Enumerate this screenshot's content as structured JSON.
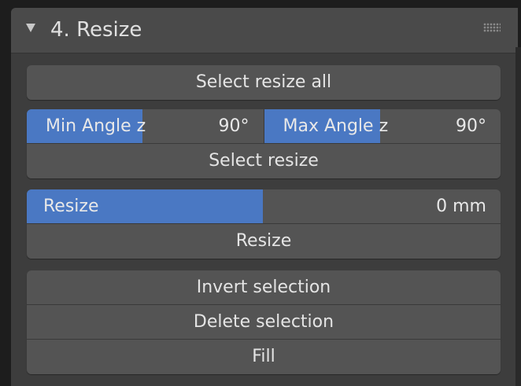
{
  "panel": {
    "title": "4. Resize",
    "collapse_icon": "triangle-down-icon",
    "grip_icon": "drag-grip-icon"
  },
  "select_resize_all": {
    "label": "Select resize all"
  },
  "angle_row": {
    "min": {
      "label": "Min Angle z",
      "value": "90°",
      "fill_fraction": 0.49
    },
    "max": {
      "label": "Max Angle z",
      "value": "90°",
      "fill_fraction": 0.49
    }
  },
  "select_resize": {
    "label": "Select resize"
  },
  "resize_field": {
    "label": "Resize",
    "value": "0 mm",
    "fill_fraction": 0.498
  },
  "resize_button": {
    "label": "Resize"
  },
  "invert_selection": {
    "label": "Invert selection"
  },
  "delete_selection": {
    "label": "Delete selection"
  },
  "fill": {
    "label": "Fill"
  },
  "colors": {
    "panel_bg": "#3d3d3d",
    "header_bg": "#4a4a4a",
    "button_bg": "#545454",
    "accent_blue": "#4a78c3",
    "text": "#e4e4e4"
  }
}
